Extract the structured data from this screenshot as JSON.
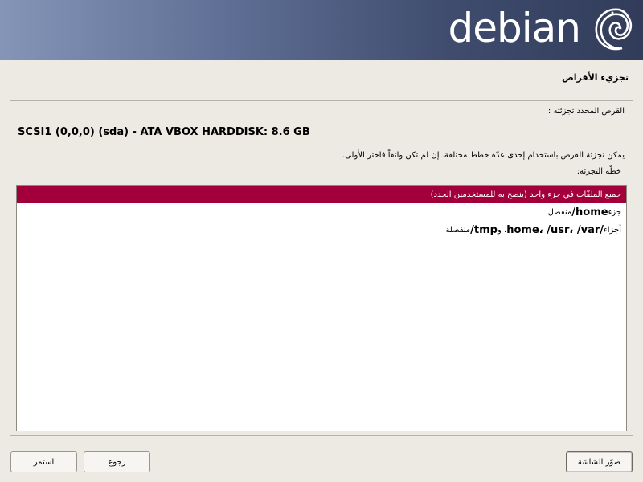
{
  "banner": {
    "logo_text": "debian",
    "logo_icon": "debian-swirl-icon"
  },
  "header": {
    "title": "تجزيء الأقراص"
  },
  "panel": {
    "disk_label": "القرص المحدد تجزئته :",
    "disk_name": "SCSI1 (0,0,0) (sda) - ATA VBOX HARDDISK: 8.6 GB",
    "help_text": "يمكن تجزئة القرص باستخدام إحدى عدّة خطط مختلفة. إن لم تكن واثقاً فاختر الأولى.",
    "scheme_label": "خطّة التجزئة:"
  },
  "schemes": [
    {
      "text": "جميع الملفّات في جزء واحد (ينصح به للمستخدمين الجدد)",
      "selected": true
    },
    {
      "prefix": "جزء ",
      "mono": "/home",
      "suffix": " منفصل"
    },
    {
      "prefix": "أجزاء ",
      "mono": "/home، /usr، /var",
      "mid": "، و ",
      "mono2": "/tmp",
      "suffix": " منفصلة"
    }
  ],
  "buttons": {
    "screenshot": "صوّر الشاشة",
    "back": "رجوع",
    "continue": "استمر"
  },
  "colors": {
    "selected_row": "#a3003b",
    "banner_dark": "#323c5a",
    "banner_light": "#8595b8"
  }
}
